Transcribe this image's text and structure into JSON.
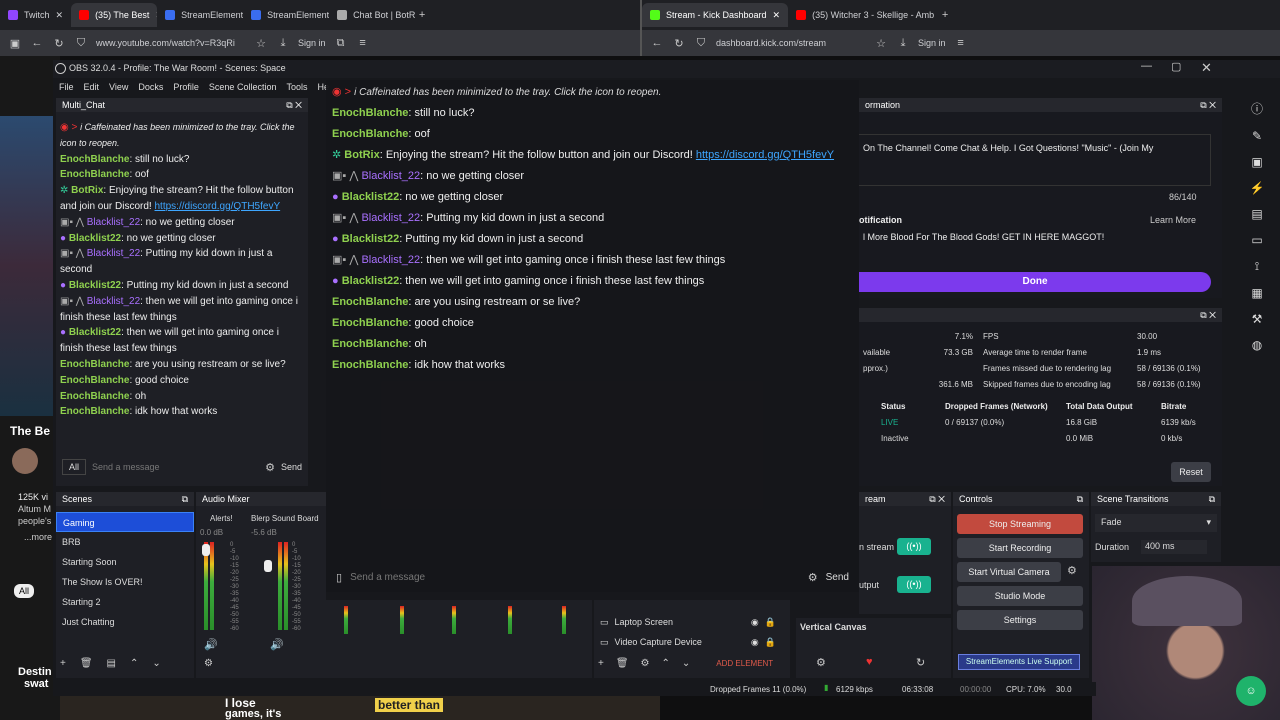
{
  "browser_left": {
    "tabs": [
      {
        "label": "Twitch",
        "color": "#9146ff"
      },
      {
        "label": "(35) The Best",
        "color": "#ff0000"
      },
      {
        "label": "StreamElements",
        "color": "#3a6df0"
      },
      {
        "label": "StreamElements",
        "color": "#3a6df0"
      },
      {
        "label": "Chat Bot | BotRi",
        "color": "#aaa"
      }
    ],
    "url": "www.youtube.com/watch?v=R3qRi",
    "signin": "Sign in"
  },
  "browser_right": {
    "tabs": [
      {
        "label": "Stream - Kick Dashboard",
        "color": "#53fc18"
      },
      {
        "label": "(35) Witcher 3 - Skellige - Amb",
        "color": "#ff0000"
      }
    ],
    "url": "dashboard.kick.com/stream",
    "signin": "Sign in"
  },
  "obs": {
    "title": "OBS 32.0.4 - Profile: The War Room! - Scenes: Space",
    "menu": [
      "File",
      "Edit",
      "View",
      "Docks",
      "Profile",
      "Scene Collection",
      "Tools",
      "He"
    ]
  },
  "multichat": {
    "title": "Multi_Chat",
    "messages": [
      {
        "user": "",
        "text": "i Caffeinated has been minimized to the tray. Click the icon to reopen.",
        "sys": true
      },
      {
        "user": "EnochBlanche",
        "text": ": still no luck?"
      },
      {
        "user": "EnochBlanche",
        "text": ": oof"
      },
      {
        "user": "BotRix",
        "text": ": Enjoying the stream? Hit the follow button and join our Discord!",
        "link": "https://discord.gg/QTH5fevY"
      },
      {
        "user2": "Blacklist_22",
        "text": ": no we getting closer"
      },
      {
        "user": "Blacklist22",
        "text": ": no we getting closer"
      },
      {
        "user2": "Blacklist_22",
        "text": ": Putting my kid down in just a second"
      },
      {
        "user": "Blacklist22",
        "text": ": Putting my kid down in just a second"
      },
      {
        "user2": "Blacklist_22",
        "text": ": then we will get into gaming once i finish these last few things"
      },
      {
        "user": "Blacklist22",
        "text": ": then we will get into gaming once i finish these last few things"
      },
      {
        "user": "EnochBlanche",
        "text": ": are you using restream or se live?"
      },
      {
        "user": "EnochBlanche",
        "text": ": good choice"
      },
      {
        "user": "EnochBlanche",
        "text": ": oh"
      },
      {
        "user": "EnochBlanche",
        "text": ": idk how that works"
      }
    ],
    "filter": "All",
    "placeholder": "Send a message",
    "send": "Send"
  },
  "bigchat": {
    "placeholder": "Send a message",
    "send": "Send"
  },
  "yt": {
    "title": "The Be",
    "subs": "125K vi",
    "line1": "Altum M",
    "line2": "people's",
    "more": "...more",
    "all": "All",
    "d1": "Destin",
    "d2": "swat",
    "cap1": "I lose",
    "cap2": "better than",
    "cap3": "games, it's"
  },
  "scenes": {
    "title": "Scenes",
    "items": [
      "Gaming",
      "BRB",
      "Starting Soon",
      "The Show Is OVER!",
      "Starting 2",
      "Just Chatting"
    ]
  },
  "mixer": {
    "title": "Audio Mixer",
    "ch1": "Alerts!",
    "ch1db": "0.0 dB",
    "ch2": "Blerp Sound Board",
    "ch2db": "-5.6 dB",
    "ticks": [
      "0",
      "-5",
      "-10",
      "-15",
      "-20",
      "-25",
      "-30",
      "-35",
      "-40",
      "-45",
      "-50",
      "-55",
      "-60"
    ]
  },
  "sources": [
    "Laptop Screen",
    "Video Capture Device"
  ],
  "add_element": "ADD ELEMENT",
  "kick": {
    "info_title": "ormation",
    "title_text": "On The Channel! Come Chat & Help. I Got Questions! \"Music\" - (Join My",
    "count": "86/140",
    "notif_label": "otification",
    "learn": "Learn More",
    "notif_text": "l More Blood For The Blood Gods! GET IN HERE MAGGOT!",
    "done": "Done"
  },
  "stats": {
    "left": [
      [
        "",
        "7.1%"
      ],
      [
        "vailable",
        "73.3 GB"
      ],
      [
        "pprox.)",
        ""
      ],
      [
        "",
        "361.6 MB"
      ]
    ],
    "right": [
      [
        "FPS",
        "30.00"
      ],
      [
        "Average time to render frame",
        "1.9 ms"
      ],
      [
        "Frames missed due to rendering lag",
        "58 / 69136 (0.1%)"
      ],
      [
        "Skipped frames due to encoding lag",
        "58 / 69136 (0.1%)"
      ]
    ],
    "headers": [
      "Status",
      "Dropped Frames (Network)",
      "Total Data Output",
      "Bitrate"
    ],
    "rows": [
      [
        "LIVE",
        "0 / 69137 (0.0%)",
        "16.8 GiB",
        "6139 kb/s"
      ],
      [
        "Inactive",
        "",
        "0.0 MiB",
        "0 kb/s"
      ]
    ],
    "reset": "Reset"
  },
  "stream": {
    "title": "ream",
    "label1": "n stream",
    "label2": "utput"
  },
  "controls": {
    "title": "Controls",
    "stop": "Stop Streaming",
    "rec": "Start Recording",
    "vcam": "Start Virtual Camera",
    "studio": "Studio Mode",
    "settings": "Settings"
  },
  "transitions": {
    "title": "Scene Transitions",
    "value": "Fade",
    "duration_label": "Duration",
    "duration": "400 ms"
  },
  "vertical": {
    "title": "Vertical Canvas"
  },
  "se_banner": "StreamElements Live Support",
  "status": {
    "dropped": "Dropped Frames 11 (0.0%)",
    "kbps": "6129 kbps",
    "time1": "06:33:08",
    "time2": "00:00:00",
    "cpu": "CPU: 7.0%",
    "fps": "30.0"
  },
  "colors": {
    "kick_purple": "#7c3aed",
    "live": "#19b28f",
    "stop": "#c24a3e"
  }
}
